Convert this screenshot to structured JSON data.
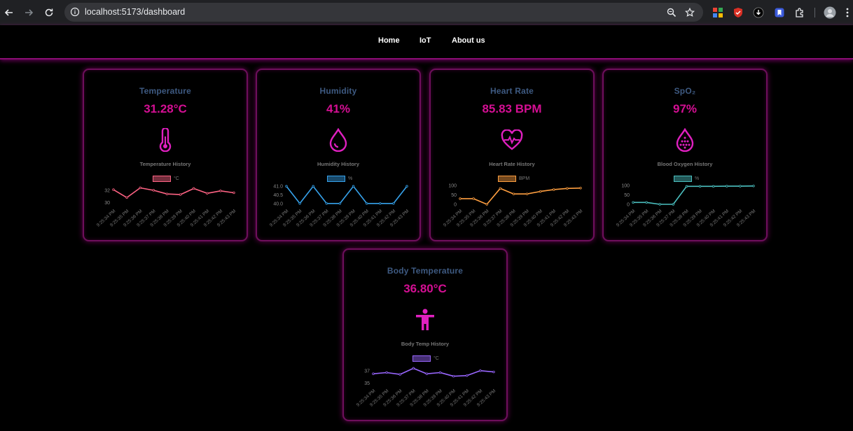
{
  "browser": {
    "url": "localhost:5173/dashboard"
  },
  "nav": {
    "links": [
      "Home",
      "IoT",
      "About us"
    ]
  },
  "cards": [
    {
      "title": "Temperature",
      "value": "31.28°C",
      "icon": "thermometer-icon",
      "history_label": "Temperature History",
      "unit": "°C",
      "color": "#ff6384",
      "chart_data": {
        "type": "line",
        "x": [
          "9:25:34 PM",
          "9:25:35 PM",
          "9:25:36 PM",
          "9:25:37 PM",
          "9:25:38 PM",
          "9:25:39 PM",
          "9:25:40 PM",
          "9:25:41 PM",
          "9:25:42 PM",
          "9:25:43 PM"
        ],
        "series": [
          {
            "name": "°C",
            "values": [
              32.1,
              30.8,
              32.4,
              32.0,
              31.4,
              31.3,
              32.3,
              31.5,
              31.9,
              31.6
            ]
          }
        ],
        "yticks": [
          {
            "v": 32,
            "label": "32"
          },
          {
            "v": 30,
            "label": "30"
          }
        ],
        "ylim": [
          29.7,
          32.8
        ]
      }
    },
    {
      "title": "Humidity",
      "value": "41%",
      "icon": "water-drop-icon",
      "history_label": "Humidity History",
      "unit": "%",
      "color": "#36a2eb",
      "chart_data": {
        "type": "line",
        "x": [
          "9:25:34 PM",
          "9:25:35 PM",
          "9:25:36 PM",
          "9:25:37 PM",
          "9:25:38 PM",
          "9:25:39 PM",
          "9:25:40 PM",
          "9:25:41 PM",
          "9:25:42 PM",
          "9:25:43 PM"
        ],
        "series": [
          {
            "name": "%",
            "values": [
              41,
              40,
              41,
              40,
              40,
              41,
              40,
              40,
              40,
              41
            ]
          }
        ],
        "yticks": [
          {
            "v": 41.0,
            "label": "41.0"
          },
          {
            "v": 40.5,
            "label": "40.5"
          },
          {
            "v": 40.0,
            "label": "40.0"
          }
        ],
        "ylim": [
          39.95,
          41.05
        ]
      }
    },
    {
      "title": "Heart Rate",
      "value": "85.83 BPM",
      "icon": "heart-pulse-icon",
      "history_label": "Heart Rate History",
      "unit": "BPM",
      "color": "#ff9f40",
      "chart_data": {
        "type": "line",
        "x": [
          "9:25:34 PM",
          "9:25:35 PM",
          "9:25:36 PM",
          "9:25:37 PM",
          "9:25:38 PM",
          "9:25:39 PM",
          "9:25:40 PM",
          "9:25:41 PM",
          "9:25:42 PM",
          "9:25:43 PM"
        ],
        "series": [
          {
            "name": "BPM",
            "values": [
              30,
              30,
              0,
              84,
              55,
              55,
              68,
              78,
              84,
              86
            ]
          }
        ],
        "yticks": [
          {
            "v": 100,
            "label": "100"
          },
          {
            "v": 50,
            "label": "50"
          },
          {
            "v": 0,
            "label": "0"
          }
        ],
        "ylim": [
          0,
          100
        ]
      }
    },
    {
      "title": "SpO₂",
      "value": "97%",
      "icon": "blood-drop-icon",
      "history_label": "Blood Oxygen History",
      "unit": "%",
      "color": "#4bc0c0",
      "chart_data": {
        "type": "line",
        "x": [
          "9:25:34 PM",
          "9:25:35 PM",
          "9:25:36 PM",
          "9:25:37 PM",
          "9:25:38 PM",
          "9:25:39 PM",
          "9:25:40 PM",
          "9:25:41 PM",
          "9:25:42 PM",
          "9:25:43 PM"
        ],
        "series": [
          {
            "name": "%",
            "values": [
              10,
              10,
              0,
              0,
              95,
              95,
              95,
              96,
              96,
              97
            ]
          }
        ],
        "yticks": [
          {
            "v": 100,
            "label": "100"
          },
          {
            "v": 50,
            "label": "50"
          },
          {
            "v": 0,
            "label": "0"
          }
        ],
        "ylim": [
          0,
          100
        ]
      }
    },
    {
      "title": "Body Temperature",
      "value": "36.80°C",
      "icon": "person-icon",
      "history_label": "Body Temp History",
      "unit": "°C",
      "color": "#9966ff",
      "chart_data": {
        "type": "line",
        "x": [
          "9:25:34 PM",
          "9:25:35 PM",
          "9:25:36 PM",
          "9:25:37 PM",
          "9:25:38 PM",
          "9:25:39 PM",
          "9:25:40 PM",
          "9:25:41 PM",
          "9:25:42 PM",
          "9:25:43 PM"
        ],
        "series": [
          {
            "name": "°C",
            "values": [
              36.5,
              36.7,
              36.4,
              37.4,
              36.5,
              36.7,
              36.1,
              36.2,
              37.0,
              36.8
            ]
          }
        ],
        "yticks": [
          {
            "v": 37,
            "label": "37"
          },
          {
            "v": 35,
            "label": "35"
          }
        ],
        "ylim": [
          34.8,
          37.9
        ]
      }
    }
  ]
}
